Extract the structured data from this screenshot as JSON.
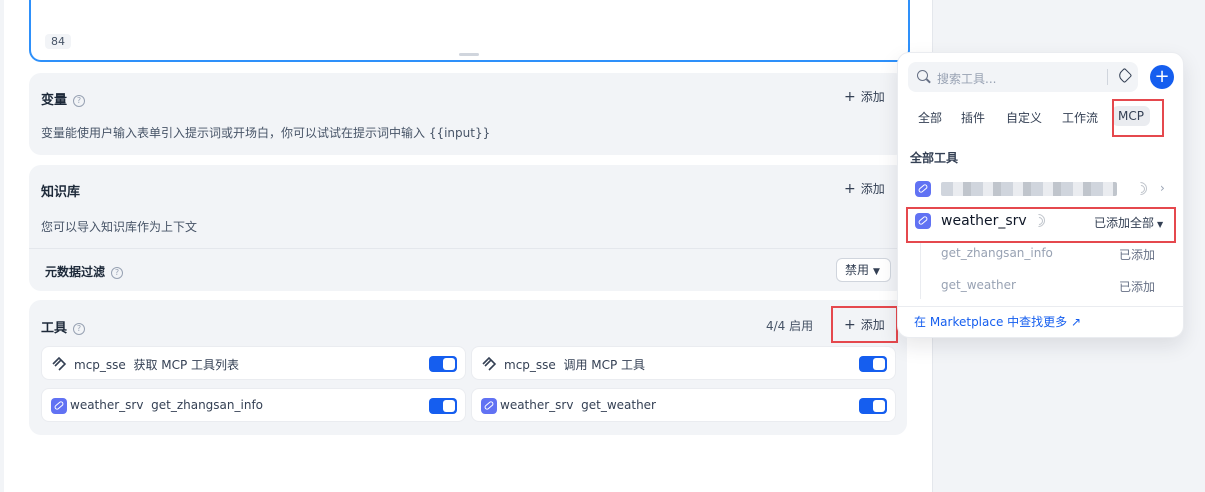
{
  "editor": {
    "char_count": "84"
  },
  "variables": {
    "title": "变量",
    "add_label": "添加",
    "description": "变量能使用户输入表单引入提示词或开场白，你可以试试在提示词中输入 {{input}}"
  },
  "knowledge": {
    "title": "知识库",
    "add_label": "添加",
    "description": "您可以导入知识库作为上下文",
    "metadata_filter_label": "元数据过滤",
    "metadata_filter_value": "禁用"
  },
  "tools": {
    "title": "工具",
    "enabled_count": "4/4 启用",
    "add_label": "添加",
    "items": [
      {
        "provider": "mcp_sse",
        "name": "获取 MCP 工具列表",
        "enabled": true,
        "icon": "mcp-icon"
      },
      {
        "provider": "mcp_sse",
        "name": "调用 MCP 工具",
        "enabled": true,
        "icon": "mcp-icon"
      },
      {
        "provider": "weather_srv",
        "name": "get_zhangsan_info",
        "enabled": true,
        "icon": "link-icon"
      },
      {
        "provider": "weather_srv",
        "name": "get_weather",
        "enabled": true,
        "icon": "link-icon"
      }
    ]
  },
  "popover": {
    "search_placeholder": "搜索工具...",
    "tabs": [
      "全部",
      "插件",
      "自定义",
      "工作流",
      "MCP"
    ],
    "section_title": "全部工具",
    "server_name": "weather_srv",
    "server_status": "已添加全部",
    "subtools": [
      {
        "name": "get_zhangsan_info",
        "status": "已添加"
      },
      {
        "name": "get_weather",
        "status": "已添加"
      }
    ],
    "marketplace_link": "在 Marketplace 中查找更多 ↗"
  },
  "colors": {
    "accent": "#155eef",
    "highlight": "#e5484d",
    "card_bg": "#f2f4f7"
  }
}
